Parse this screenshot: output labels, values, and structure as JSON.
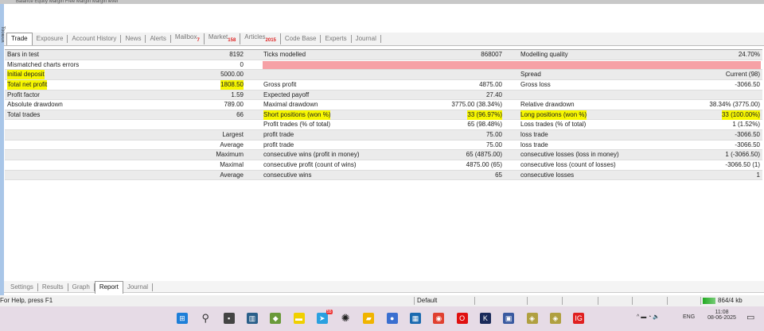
{
  "top_strip": "Balance Equity Margin Free Margin Margin level",
  "side_label": "Toolbox",
  "terminal_tabs": [
    {
      "label": "Trade"
    },
    {
      "label": "Exposure"
    },
    {
      "label": "Account History"
    },
    {
      "label": "News"
    },
    {
      "label": "Alerts"
    },
    {
      "label": "Mailbox",
      "badge": "7"
    },
    {
      "label": "Market",
      "badge": "158"
    },
    {
      "label": "Articles",
      "badge": "2015"
    },
    {
      "label": "Code Base"
    },
    {
      "label": "Experts"
    },
    {
      "label": "Journal"
    }
  ],
  "report_rows": [
    [
      "Bars in test",
      "8192",
      "Ticks modelled",
      "868007",
      "Modelling quality",
      "24.70%"
    ],
    [
      "Mismatched charts errors",
      "0",
      "",
      "",
      "",
      ""
    ],
    [
      "Initial deposit",
      "5000.00",
      "",
      "",
      "Spread",
      "Current (98)"
    ],
    [
      "Total net profit",
      "1808.50",
      "Gross profit",
      "4875.00",
      "Gross loss",
      "-3066.50"
    ],
    [
      "Profit factor",
      "1.59",
      "Expected payoff",
      "27.40",
      "",
      ""
    ],
    [
      "Absolute drawdown",
      "789.00",
      "Maximal drawdown",
      "3775.00 (38.34%)",
      "Relative drawdown",
      "38.34% (3775.00)"
    ],
    [
      "Total trades",
      "66",
      "Short positions (won %)",
      "33 (96.97%)",
      "Long positions (won %)",
      "33 (100.00%)"
    ],
    [
      "",
      "",
      "Profit trades (% of total)",
      "65 (98.48%)",
      "Loss trades (% of total)",
      "1 (1.52%)"
    ],
    [
      "",
      "Largest",
      "profit trade",
      "75.00",
      "loss trade",
      "-3066.50"
    ],
    [
      "",
      "Average",
      "profit trade",
      "75.00",
      "loss trade",
      "-3066.50"
    ],
    [
      "",
      "Maximum",
      "consecutive wins (profit in money)",
      "65 (4875.00)",
      "consecutive losses (loss in money)",
      "1 (-3066.50)"
    ],
    [
      "",
      "Maximal",
      "consecutive profit (count of wins)",
      "4875.00 (65)",
      "consecutive loss (count of losses)",
      "-3066.50 (1)"
    ],
    [
      "",
      "Average",
      "consecutive wins",
      "65",
      "consecutive losses",
      "1"
    ]
  ],
  "highlights": [
    [
      2,
      0
    ],
    [
      3,
      0
    ],
    [
      3,
      1
    ],
    [
      6,
      2
    ],
    [
      6,
      3
    ],
    [
      6,
      4
    ],
    [
      6,
      5
    ]
  ],
  "quality_bar_color": "#f6a1a6",
  "tester_tabs": [
    {
      "label": "Settings"
    },
    {
      "label": "Results"
    },
    {
      "label": "Graph"
    },
    {
      "label": "Report",
      "active": true
    },
    {
      "label": "Journal"
    }
  ],
  "status": {
    "help": "For Help, press F1",
    "profile": "Default",
    "traffic": "864/4 kb"
  },
  "taskbar": {
    "time": "11:08",
    "date": "08-06-2025",
    "lang": "ENG",
    "telegram_badge": "55",
    "apps": [
      "start",
      "search",
      "task-view",
      "widgets",
      "metatrader",
      "notes",
      "telegram",
      "chatgpt",
      "file-explorer",
      "browser",
      "store",
      "chrome",
      "opera",
      "kite",
      "network-app",
      "mt4-a",
      "mt4-b",
      "ig"
    ]
  }
}
